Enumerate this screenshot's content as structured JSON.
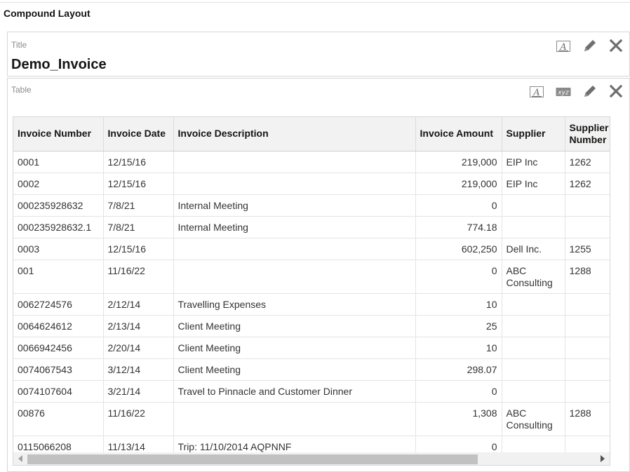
{
  "layout": {
    "title": "Compound Layout"
  },
  "title_view": {
    "label": "Title",
    "heading": "Demo_Invoice",
    "icons": [
      "format-text-icon",
      "edit-pencil-icon",
      "close-icon"
    ]
  },
  "table_view": {
    "label": "Table",
    "icons": [
      "format-text-icon",
      "xyz-icon",
      "edit-pencil-icon",
      "close-icon"
    ],
    "xyz_text": "xyz",
    "columns": [
      "Invoice Number",
      "Invoice Date",
      "Invoice Description",
      "Invoice Amount",
      "Supplier",
      "Supplier Number"
    ],
    "rows": [
      [
        "0001",
        "12/15/16",
        "",
        "219,000",
        "EIP Inc",
        "1262"
      ],
      [
        "0002",
        "12/15/16",
        "",
        "219,000",
        "EIP Inc",
        "1262"
      ],
      [
        "000235928632",
        "7/8/21",
        "Internal Meeting",
        "0",
        "",
        ""
      ],
      [
        "000235928632.1",
        "7/8/21",
        "Internal Meeting",
        "774.18",
        "",
        ""
      ],
      [
        "0003",
        "12/15/16",
        "",
        "602,250",
        "Dell Inc.",
        "1255"
      ],
      [
        "001",
        "11/16/22",
        "",
        "0",
        "ABC Consulting",
        "1288"
      ],
      [
        "0062724576",
        "2/12/14",
        "Travelling Expenses",
        "10",
        "",
        ""
      ],
      [
        "0064624612",
        "2/13/14",
        "Client Meeting",
        "25",
        "",
        ""
      ],
      [
        "0066942456",
        "2/20/14",
        "Client Meeting",
        "10",
        "",
        ""
      ],
      [
        "0074067543",
        "3/12/14",
        "Client Meeting",
        "298.07",
        "",
        ""
      ],
      [
        "0074107604",
        "3/21/14",
        "Travel to Pinnacle and Customer Dinner",
        "0",
        "",
        ""
      ],
      [
        "00876",
        "11/16/22",
        "",
        "1,308",
        "ABC Consulting",
        "1288"
      ],
      [
        "0115066208",
        "11/13/14",
        "Trip: 11/10/2014 AQPNNF",
        "0",
        "",
        ""
      ]
    ]
  },
  "colors": {
    "icon": "#6f6f6f",
    "header_bg": "#f2f2f2",
    "border": "#d6d6d6"
  }
}
